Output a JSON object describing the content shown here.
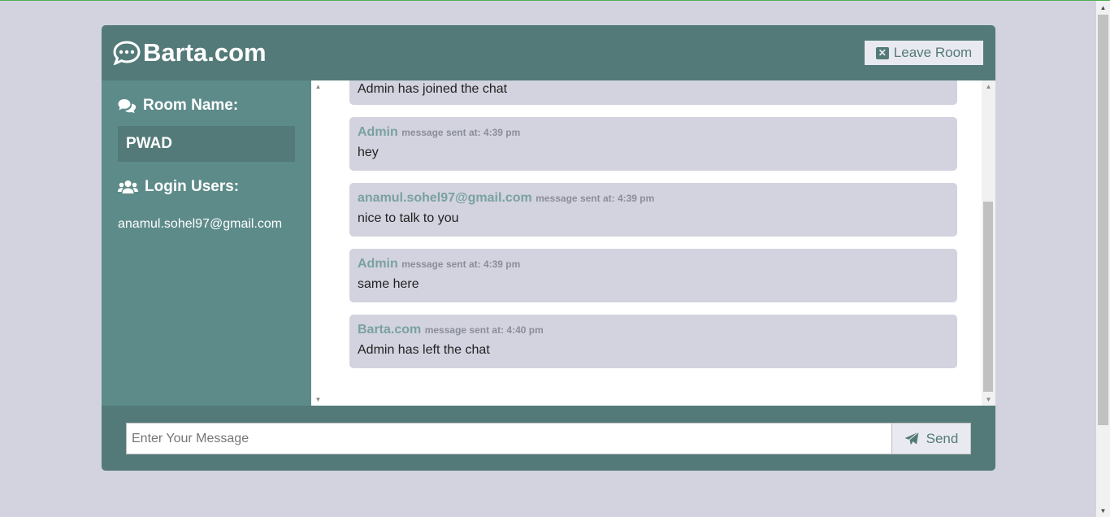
{
  "header": {
    "brand": "Barta.com",
    "leave_button": "Leave Room"
  },
  "sidebar": {
    "room_label": "Room Name:",
    "room_name": "PWAD",
    "users_label": "Login Users:",
    "users": [
      "anamul.sohel97@gmail.com"
    ]
  },
  "messages": [
    {
      "user": "",
      "time": "",
      "text": "Admin has joined the chat"
    },
    {
      "user": "Admin",
      "time": "message sent at: 4:39 pm",
      "text": "hey"
    },
    {
      "user": "anamul.sohel97@gmail.com",
      "time": "message sent at: 4:39 pm",
      "text": "nice to talk to you"
    },
    {
      "user": "Admin",
      "time": "message sent at: 4:39 pm",
      "text": "same here"
    },
    {
      "user": "Barta.com",
      "time": "message sent at: 4:40 pm",
      "text": "Admin has left the chat"
    }
  ],
  "form": {
    "placeholder": "Enter Your Message",
    "send_label": "Send"
  },
  "colors": {
    "header": "#537a79",
    "sidebar": "#5d8b8a",
    "page_bg": "#d2d3df",
    "username": "#7aa19f"
  },
  "icons": {
    "brand": "comment-dots-icon",
    "leave": "close-square-icon",
    "room": "comments-icon",
    "users": "users-icon",
    "send": "paper-plane-icon"
  }
}
